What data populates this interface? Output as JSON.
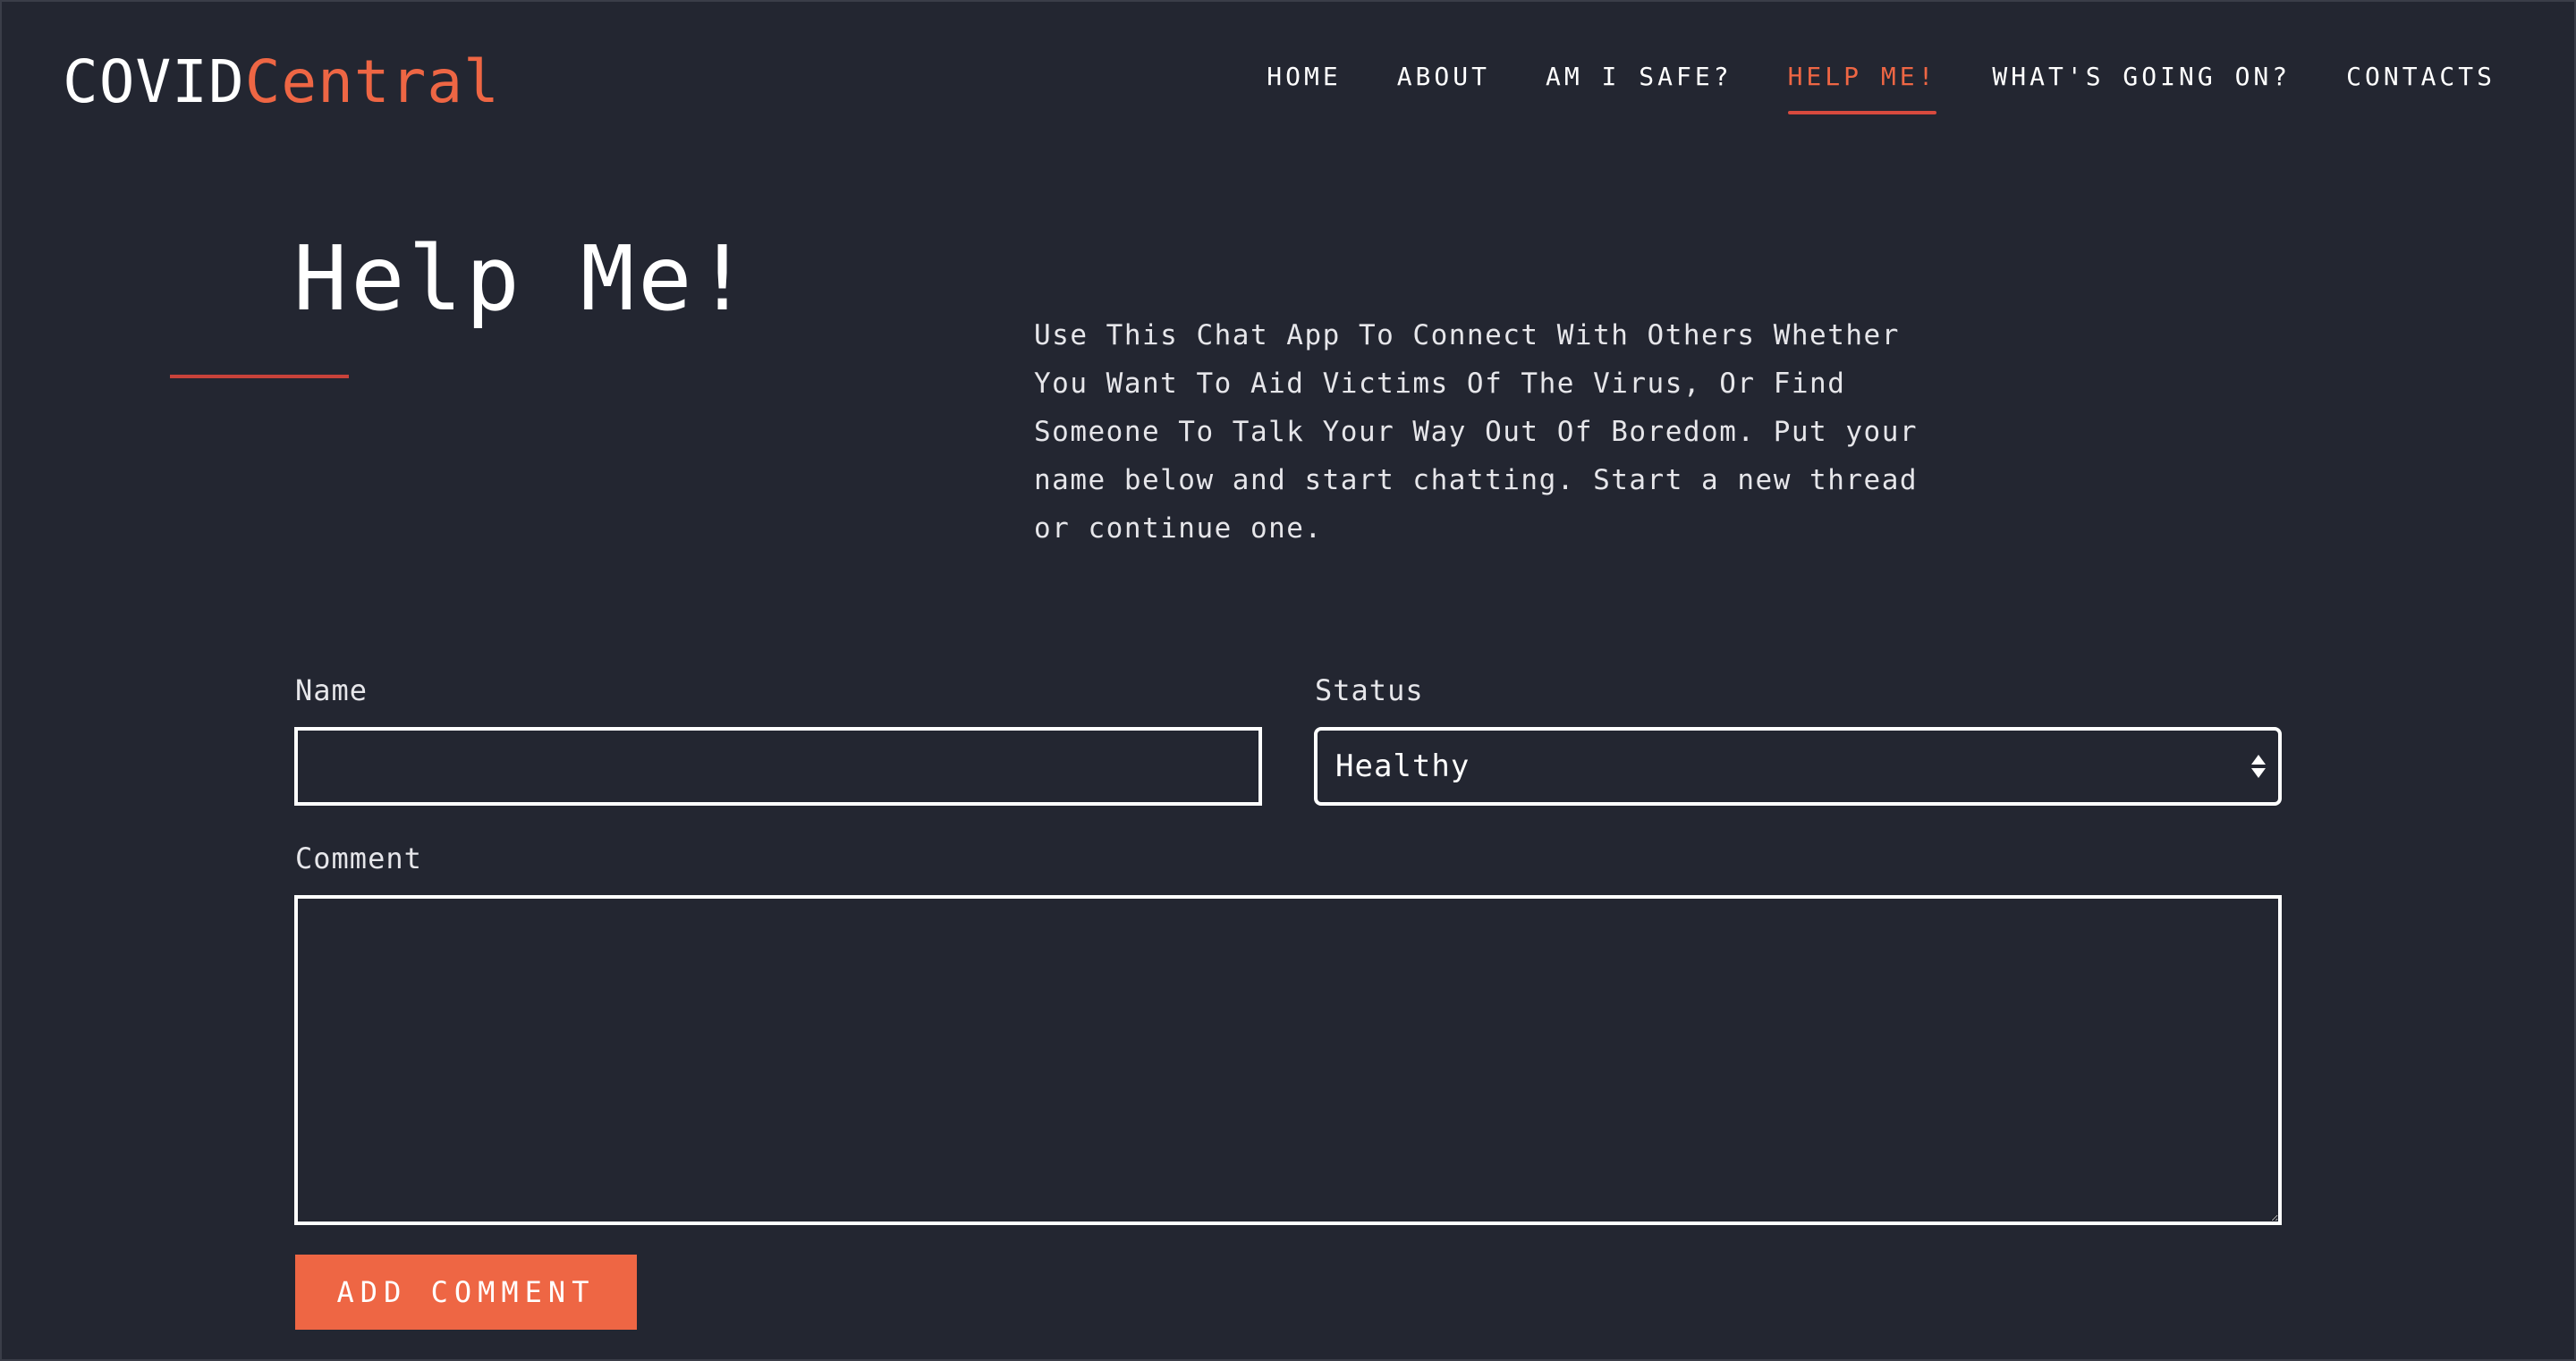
{
  "brand": {
    "part1": "COVID",
    "part2": "Central",
    "accent_color": "#ee6644",
    "background_color": "#232631"
  },
  "nav": {
    "items": [
      {
        "label": "HOME",
        "active": false
      },
      {
        "label": "ABOUT",
        "active": false
      },
      {
        "label": "AM I SAFE?",
        "active": false
      },
      {
        "label": "HELP ME!",
        "active": true
      },
      {
        "label": "WHAT'S GOING ON?",
        "active": false
      },
      {
        "label": "CONTACTS",
        "active": false
      }
    ]
  },
  "hero": {
    "title": "Help Me!",
    "intro": "Use This Chat App To Connect With Others Whether You Want To Aid Victims Of The Virus, Or Find Someone To Talk Your Way Out Of Boredom. Put your name below and start chatting. Start a new thread or continue one."
  },
  "form": {
    "name_label": "Name",
    "name_value": "",
    "status_label": "Status",
    "status_value": "Healthy",
    "comment_label": "Comment",
    "comment_value": "",
    "submit_label": "ADD COMMENT"
  }
}
